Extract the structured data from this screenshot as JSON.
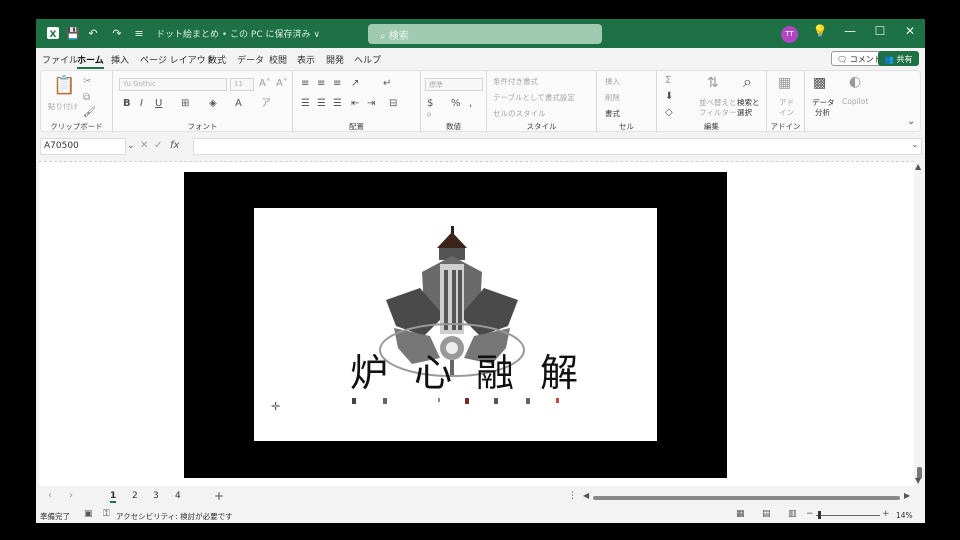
{
  "titlebar": {
    "title": "ドット絵まとめ • この PC に保存済み ∨",
    "search_placeholder": "検索",
    "avatar_initials": "TT",
    "minimize": "—",
    "maximize": "☐",
    "close": "✕"
  },
  "tabs": [
    "ファイル",
    "ホーム",
    "挿入",
    "ページ レイアウト",
    "数式",
    "データ",
    "校閲",
    "表示",
    "開発",
    "ヘルプ"
  ],
  "active_tab": "ホーム",
  "comment_label": "コメント",
  "share_label": "共有",
  "ribbon": {
    "clipboard": {
      "paste": "貼り付け",
      "label": "クリップボード"
    },
    "font": {
      "name": "Yu Gothic",
      "size": "11",
      "label": "フォント"
    },
    "alignment": {
      "label": "配置"
    },
    "number": {
      "format": "標準",
      "label": "数値"
    },
    "styles": {
      "conditional": "条件付き書式",
      "table": "テーブルとして書式設定",
      "cell": "セルのスタイル",
      "label": "スタイル"
    },
    "cells": {
      "insert": "挿入",
      "delete": "削除",
      "format": "書式",
      "label": "セル"
    },
    "editing": {
      "sort": "並べ替えと",
      "filter": "フィルター",
      "find": "検索と",
      "select": "選択",
      "label": "編集"
    },
    "addins": {
      "line1": "アド",
      "line2": "イン",
      "label": "アドイン"
    },
    "analysis": {
      "line1": "データ",
      "line2": "分析"
    },
    "copilot": "Copilot"
  },
  "formula_bar": {
    "name_box": "A70500",
    "fx": "fx",
    "value": ""
  },
  "artwork": {
    "title_chars": [
      "炉",
      "心",
      "融",
      "解"
    ]
  },
  "sheets": [
    "1",
    "2",
    "3",
    "4"
  ],
  "active_sheet": "1",
  "status": {
    "ready": "準備完了",
    "accessibility": "アクセシビリティ: 検討が必要です",
    "zoom": "14%"
  },
  "colors": {
    "accent": "#1e7145",
    "avatar": "#b146c2"
  }
}
